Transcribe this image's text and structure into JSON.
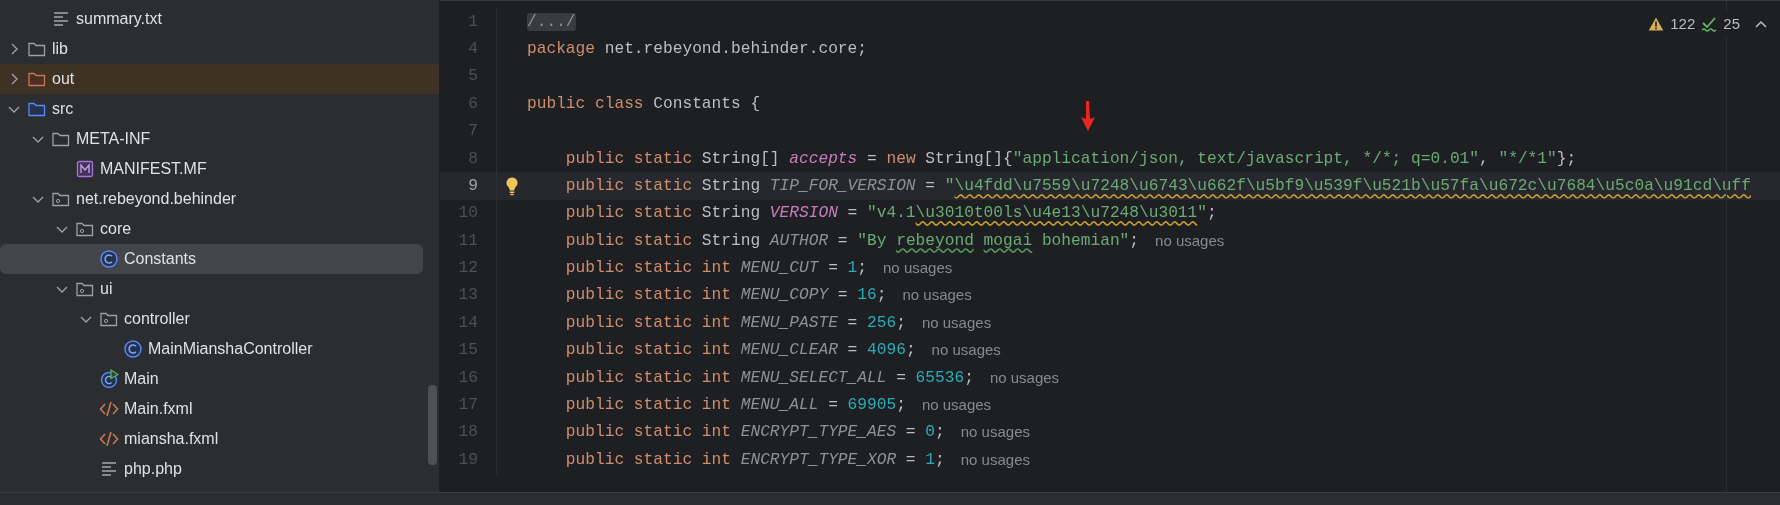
{
  "project_tree": [
    {
      "children": [
        {
          "name": "summary.txt",
          "kind": "text",
          "selected": false
        }
      ]
    },
    {
      "name": "lib",
      "kind": "folder",
      "expanded": false,
      "selected": false
    },
    {
      "name": "out",
      "kind": "excluded",
      "expanded": false,
      "selected": false
    },
    {
      "name": "src",
      "kind": "source",
      "expanded": true,
      "selected": false,
      "children": [
        {
          "name": "META-INF",
          "kind": "folder",
          "expanded": true,
          "selected": false,
          "children": [
            {
              "name": "MANIFEST.MF",
              "kind": "manifest",
              "selected": false
            }
          ]
        },
        {
          "name": "net.rebeyond.behinder",
          "kind": "package",
          "expanded": true,
          "selected": false,
          "children": [
            {
              "name": "core",
              "kind": "package",
              "expanded": true,
              "selected": false,
              "children": [
                {
                  "name": "Constants",
                  "kind": "class",
                  "selected": true
                }
              ]
            },
            {
              "name": "ui",
              "kind": "package",
              "expanded": true,
              "selected": false,
              "children": [
                {
                  "name": "controller",
                  "kind": "package",
                  "expanded": true,
                  "selected": false,
                  "children": [
                    {
                      "name": "MainMianshaController",
                      "kind": "class",
                      "selected": false
                    }
                  ]
                },
                {
                  "name": "Main",
                  "kind": "main",
                  "selected": false
                },
                {
                  "name": "Main.fxml",
                  "kind": "xml",
                  "selected": false
                },
                {
                  "name": "miansha.fxml",
                  "kind": "xml",
                  "selected": false
                },
                {
                  "name": "php.php",
                  "kind": "text",
                  "selected": false
                }
              ]
            }
          ]
        }
      ]
    }
  ],
  "inspections": {
    "warnings": "122",
    "weak_warnings": "25"
  },
  "code_lines": [
    {
      "number": "1",
      "current": false,
      "tokens": [
        {
          "kind": "fold",
          "text": "/.../"
        }
      ]
    },
    {
      "number": "4",
      "current": false,
      "tokens": [
        {
          "kind": "kw",
          "text": "package "
        },
        {
          "kind": "plain",
          "text": "net.rebeyond.behinder.core;"
        }
      ]
    },
    {
      "number": "5",
      "current": false
    },
    {
      "number": "6",
      "current": false,
      "tokens": [
        {
          "kind": "kw",
          "text": "public class "
        },
        {
          "kind": "plain",
          "text": "Constants {"
        }
      ]
    },
    {
      "number": "7",
      "current": false
    },
    {
      "number": "8",
      "current": false,
      "tokens": [
        {
          "kind": "kw",
          "text": "    public static "
        },
        {
          "kind": "plain",
          "text": "String[] "
        },
        {
          "kind": "field",
          "text": "accepts"
        },
        {
          "kind": "plain",
          "text": " = "
        },
        {
          "kind": "kw",
          "text": "new "
        },
        {
          "kind": "plain",
          "text": "String[]{"
        },
        {
          "kind": "str",
          "text": "\"application/json, text/javascript, */*; q=0.01\""
        },
        {
          "kind": "plain",
          "text": ", "
        },
        {
          "kind": "str",
          "text": "\"*/*1\""
        },
        {
          "kind": "plain",
          "text": "};"
        }
      ]
    },
    {
      "number": "9",
      "current": true,
      "tokens": [
        {
          "kind": "kw",
          "text": "    public static "
        },
        {
          "kind": "plain",
          "text": "String "
        },
        {
          "kind": "unused",
          "text": "TIP_FOR_VERSION"
        },
        {
          "kind": "plain",
          "text": " = "
        },
        {
          "kind": "str",
          "text": "\""
        },
        {
          "kind": "str-warn",
          "text": "\\u4fdd\\u7559\\u7248\\u6743\\u662f\\u5bf9\\u539f\\u521b\\u57fa\\u672c\\u7684\\u5c0a\\u91cd\\uff"
        }
      ]
    },
    {
      "number": "10",
      "current": false,
      "tokens": [
        {
          "kind": "kw",
          "text": "    public static "
        },
        {
          "kind": "plain",
          "text": "String "
        },
        {
          "kind": "field",
          "text": "VERSION"
        },
        {
          "kind": "plain",
          "text": " = "
        },
        {
          "kind": "str",
          "text": "\"v4.1"
        },
        {
          "kind": "str-warn",
          "text": "\\u3010t00ls\\u4e13\\u7248\\u3011"
        },
        {
          "kind": "str",
          "text": "\""
        },
        {
          "kind": "plain",
          "text": ";"
        }
      ]
    },
    {
      "number": "11",
      "current": false,
      "tokens": [
        {
          "kind": "kw",
          "text": "    public static "
        },
        {
          "kind": "plain",
          "text": "String "
        },
        {
          "kind": "unused",
          "text": "AUTHOR"
        },
        {
          "kind": "plain",
          "text": " = "
        },
        {
          "kind": "str",
          "text": "\"By "
        },
        {
          "kind": "str-typo",
          "text": "rebeyond mogai"
        },
        {
          "kind": "str",
          "text": " bohemian\""
        },
        {
          "kind": "plain",
          "text": ";"
        }
      ],
      "hint": "no usages"
    },
    {
      "number": "12",
      "current": false,
      "tokens": [
        {
          "kind": "kw",
          "text": "    public static int "
        },
        {
          "kind": "unused",
          "text": "MENU_CUT"
        },
        {
          "kind": "plain",
          "text": " = "
        },
        {
          "kind": "num",
          "text": "1"
        },
        {
          "kind": "plain",
          "text": ";"
        }
      ],
      "hint": "no usages"
    },
    {
      "number": "13",
      "current": false,
      "tokens": [
        {
          "kind": "kw",
          "text": "    public static int "
        },
        {
          "kind": "unused",
          "text": "MENU_COPY"
        },
        {
          "kind": "plain",
          "text": " = "
        },
        {
          "kind": "num",
          "text": "16"
        },
        {
          "kind": "plain",
          "text": ";"
        }
      ],
      "hint": "no usages"
    },
    {
      "number": "14",
      "current": false,
      "tokens": [
        {
          "kind": "kw",
          "text": "    public static int "
        },
        {
          "kind": "unused",
          "text": "MENU_PASTE"
        },
        {
          "kind": "plain",
          "text": " = "
        },
        {
          "kind": "num",
          "text": "256"
        },
        {
          "kind": "plain",
          "text": ";"
        }
      ],
      "hint": "no usages"
    },
    {
      "number": "15",
      "current": false,
      "tokens": [
        {
          "kind": "kw",
          "text": "    public static int "
        },
        {
          "kind": "unused",
          "text": "MENU_CLEAR"
        },
        {
          "kind": "plain",
          "text": " = "
        },
        {
          "kind": "num",
          "text": "4096"
        },
        {
          "kind": "plain",
          "text": ";"
        }
      ],
      "hint": "no usages"
    },
    {
      "number": "16",
      "current": false,
      "tokens": [
        {
          "kind": "kw",
          "text": "    public static int "
        },
        {
          "kind": "unused",
          "text": "MENU_SELECT_ALL"
        },
        {
          "kind": "plain",
          "text": " = "
        },
        {
          "kind": "num",
          "text": "65536"
        },
        {
          "kind": "plain",
          "text": ";"
        }
      ],
      "hint": "no usages"
    },
    {
      "number": "17",
      "current": false,
      "tokens": [
        {
          "kind": "kw",
          "text": "    public static int "
        },
        {
          "kind": "unused",
          "text": "MENU_ALL"
        },
        {
          "kind": "plain",
          "text": " = "
        },
        {
          "kind": "num",
          "text": "69905"
        },
        {
          "kind": "plain",
          "text": ";"
        }
      ],
      "hint": "no usages"
    },
    {
      "number": "18",
      "current": false,
      "tokens": [
        {
          "kind": "kw",
          "text": "    public static int "
        },
        {
          "kind": "unused",
          "text": "ENCRYPT_TYPE_AES"
        },
        {
          "kind": "plain",
          "text": " = "
        },
        {
          "kind": "num",
          "text": "0"
        },
        {
          "kind": "plain",
          "text": ";"
        }
      ],
      "hint": "no usages"
    },
    {
      "number": "19",
      "current": false,
      "tokens": [
        {
          "kind": "kw",
          "text": "    public static int "
        },
        {
          "kind": "unused",
          "text": "ENCRYPT_TYPE_XOR"
        },
        {
          "kind": "plain",
          "text": " = "
        },
        {
          "kind": "num",
          "text": "1"
        },
        {
          "kind": "plain",
          "text": ";"
        }
      ],
      "hint": "no usages"
    }
  ]
}
